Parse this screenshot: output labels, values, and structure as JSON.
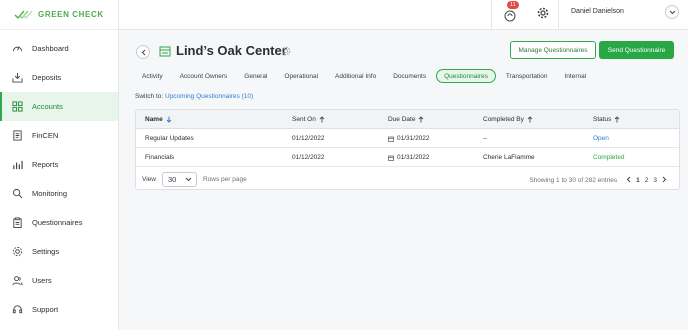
{
  "brand": {
    "name": "GREEN CHECK",
    "accent": "#2fa84f"
  },
  "sidebar": {
    "items": [
      {
        "label": "Dashboard",
        "icon": "speedometer-icon"
      },
      {
        "label": "Deposits",
        "icon": "deposit-tray-icon"
      },
      {
        "label": "Accounts",
        "icon": "grid-icon",
        "active": true
      },
      {
        "label": "FinCEN",
        "icon": "document-icon"
      },
      {
        "label": "Reports",
        "icon": "bar-chart-icon"
      },
      {
        "label": "Monitoring",
        "icon": "magnifier-icon"
      },
      {
        "label": "Questionnaires",
        "icon": "clipboard-icon"
      },
      {
        "label": "Settings",
        "icon": "gear-icon"
      },
      {
        "label": "Users",
        "icon": "users-icon"
      },
      {
        "label": "Support",
        "icon": "headset-icon"
      }
    ]
  },
  "header": {
    "notification_count": "11",
    "user_name": "Daniel Danielson"
  },
  "page": {
    "title": "Lind’s Oak Center",
    "manage_label": "Manage Questionnaires",
    "send_label": "Send Questionnaire"
  },
  "tabs": [
    {
      "label": "Activity"
    },
    {
      "label": "Account Owners"
    },
    {
      "label": "General"
    },
    {
      "label": "Operational"
    },
    {
      "label": "Additional Info"
    },
    {
      "label": "Documents"
    },
    {
      "label": "Questionnaires",
      "active": true
    },
    {
      "label": "Transportation"
    },
    {
      "label": "Internal"
    }
  ],
  "switch": {
    "prefix": "Switch to:",
    "link": "Upcoming Questionnaires (10)"
  },
  "table": {
    "columns": [
      "Name",
      "Sent On",
      "Due Date",
      "Completed By",
      "Status"
    ],
    "rows": [
      {
        "name": "Regular Updates",
        "sent_on": "01/12/2022",
        "due_date": "01/31/2022",
        "completed_by": "--",
        "status": "Open"
      },
      {
        "name": "Financials",
        "sent_on": "01/12/2022",
        "due_date": "01/31/2022",
        "completed_by": "Cherie LaFlamme",
        "status": "Completed"
      }
    ],
    "footer": {
      "view_label": "View",
      "per_page": "30",
      "per_page_label": "Rows per page",
      "summary": "Showing 1 to 30 of 282 entries",
      "pages": [
        "1",
        "2",
        "3"
      ]
    }
  }
}
